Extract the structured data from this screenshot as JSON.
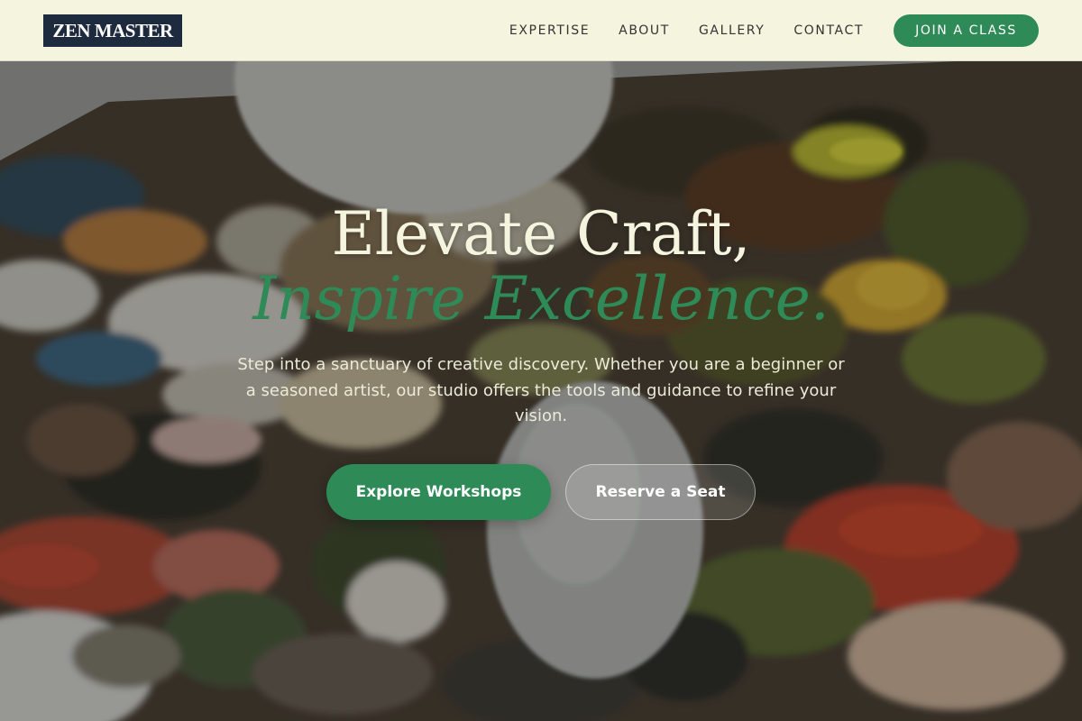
{
  "header": {
    "logo": "ZEN MASTER",
    "nav": [
      {
        "label": "EXPERTISE"
      },
      {
        "label": "ABOUT"
      },
      {
        "label": "GALLERY"
      },
      {
        "label": "CONTACT"
      }
    ],
    "cta_label": "JOIN A CLASS"
  },
  "hero": {
    "title_line1": "Elevate Craft,",
    "title_line2": "Inspire Excellence.",
    "subtitle": "Step into a sanctuary of creative discovery. Whether you are a beginner or a seasoned artist, our studio offers the tools and guidance to refine your vision.",
    "primary_button": "Explore Workshops",
    "secondary_button": "Reserve a Seat"
  },
  "colors": {
    "header_bg": "#f5f5df",
    "logo_bg": "#1e2a3d",
    "accent_green": "#2e8b57",
    "hero_title": "#f5f5df"
  }
}
